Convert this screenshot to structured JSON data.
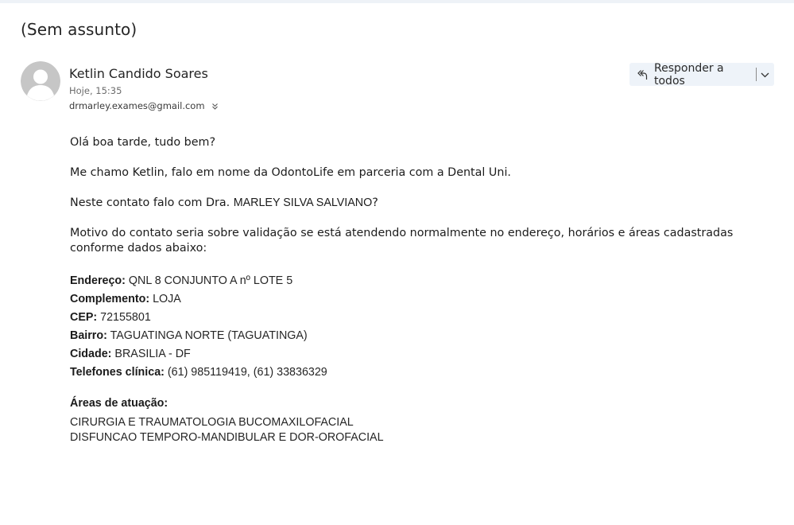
{
  "email": {
    "subject": "(Sem assunto)",
    "sender": {
      "name": "Ketlin Candido Soares",
      "time": "Hoje, 15:35",
      "recipient": "drmarley.exames@gmail.com"
    },
    "actions": {
      "reply_all_label": "Responder a todos"
    },
    "body": {
      "greeting": "Olá boa tarde, tudo bem?",
      "intro": "Me chamo Ketlin, falo em nome da OdontoLife em parceria com a Dental Uni.",
      "question_prefix": "Neste contato falo com Dra. ",
      "question_name": "MARLEY SILVA SALVIANO",
      "question_suffix": "?",
      "reason": "Motivo do contato seria sobre validação se está atendendo normalmente no endereço, horários e áreas cadastradas conforme dados abaixo:",
      "details": [
        {
          "label": "Endereço:",
          "value": "QNL 8 CONJUNTO A nº LOTE 5"
        },
        {
          "label": "Complemento:",
          "value": "LOJA"
        },
        {
          "label": "CEP:",
          "value": "72155801"
        },
        {
          "label": "Bairro:",
          "value": "TAGUATINGA NORTE (TAGUATINGA)"
        },
        {
          "label": "Cidade:",
          "value": "BRASILIA - DF"
        },
        {
          "label": "Telefones clínica:",
          "value": "(61) 985119419, (61) 33836329"
        }
      ],
      "areas_title": "Áreas de atuação:",
      "areas": [
        "CIRURGIA E TRAUMATOLOGIA BUCOMAXILOFACIAL",
        "DISFUNCAO TEMPORO-MANDIBULAR E DOR-OROFACIAL"
      ]
    }
  },
  "icons": {
    "avatar": "person-avatar-icon",
    "reply_all": "reply-all-icon",
    "dropdown": "chevron-down-icon",
    "expand_recipients": "double-chevron-down-icon"
  },
  "colors": {
    "reply_button_bg": "#eef3f9",
    "avatar_bg": "#c8c8c8",
    "topbar": "#eef2f7"
  }
}
